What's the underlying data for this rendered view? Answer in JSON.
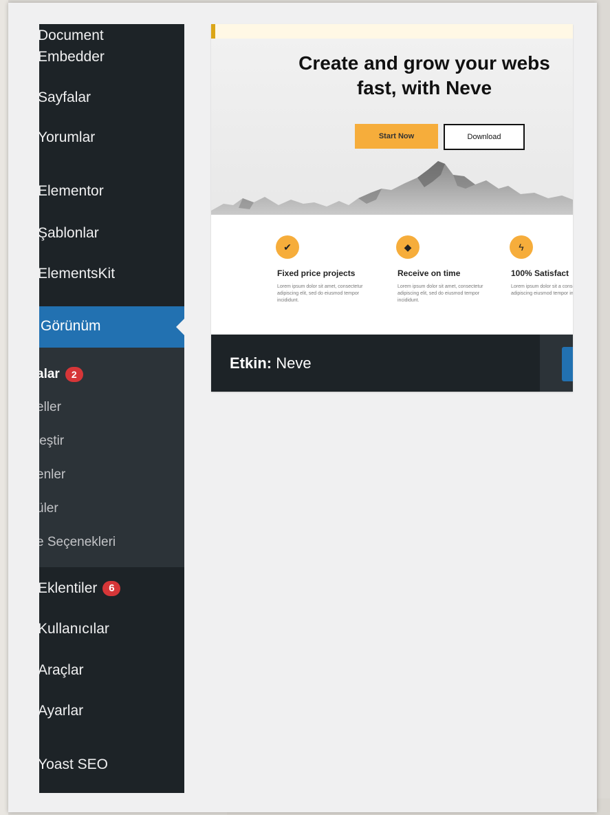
{
  "sidebar": {
    "items_top": [
      {
        "label_line1": "Document",
        "label_line2": "Embedder"
      },
      {
        "label": "Sayfalar"
      },
      {
        "label": "Yorumlar"
      },
      {
        "label": "Elementor"
      },
      {
        "label": "Şablonlar"
      },
      {
        "label": "ElementsKit"
      }
    ],
    "active": {
      "label": "Görünüm"
    },
    "submenu": [
      {
        "label": "alar",
        "badge": "2"
      },
      {
        "label": "eller"
      },
      {
        "label": "leştir"
      },
      {
        "label": "enler"
      },
      {
        "label": "üler"
      },
      {
        "label": "e Seçenekleri"
      }
    ],
    "items_bottom": [
      {
        "label": "Eklentiler",
        "badge": "6"
      },
      {
        "label": "Kullanıcılar"
      },
      {
        "label": "Araçlar"
      },
      {
        "label": "Ayarlar"
      },
      {
        "label": "Yoast SEO"
      }
    ]
  },
  "theme_card": {
    "hero_title_line1": "Create and grow your webs",
    "hero_title_line2": "fast, with Neve",
    "start_button": "Start Now",
    "download_button": "Download",
    "features": [
      {
        "title": "Fixed price projects",
        "desc": "Lorem ipsum dolor sit amet, consectetur adipiscing elit, sed do eiusmod tempor incididunt."
      },
      {
        "title": "Receive on time",
        "desc": "Lorem ipsum dolor sit amet, consectetur adipiscing elit, sed do eiusmod tempor incididunt."
      },
      {
        "title": "100% Satisfact",
        "desc": "Lorem ipsum dolor sit a consectetur adipiscing eiusmod tempor incidi"
      }
    ],
    "feature_icons": [
      "check-icon",
      "diamond-icon",
      "lightning-icon"
    ],
    "footer": {
      "prefix": "Etkin:",
      "theme_name": "Neve"
    }
  },
  "colors": {
    "sidebar_bg": "#1d2327",
    "submenu_bg": "#2c3338",
    "active_bg": "#2271b1",
    "badge_bg": "#d63638",
    "accent_orange": "#f6ad3b"
  }
}
